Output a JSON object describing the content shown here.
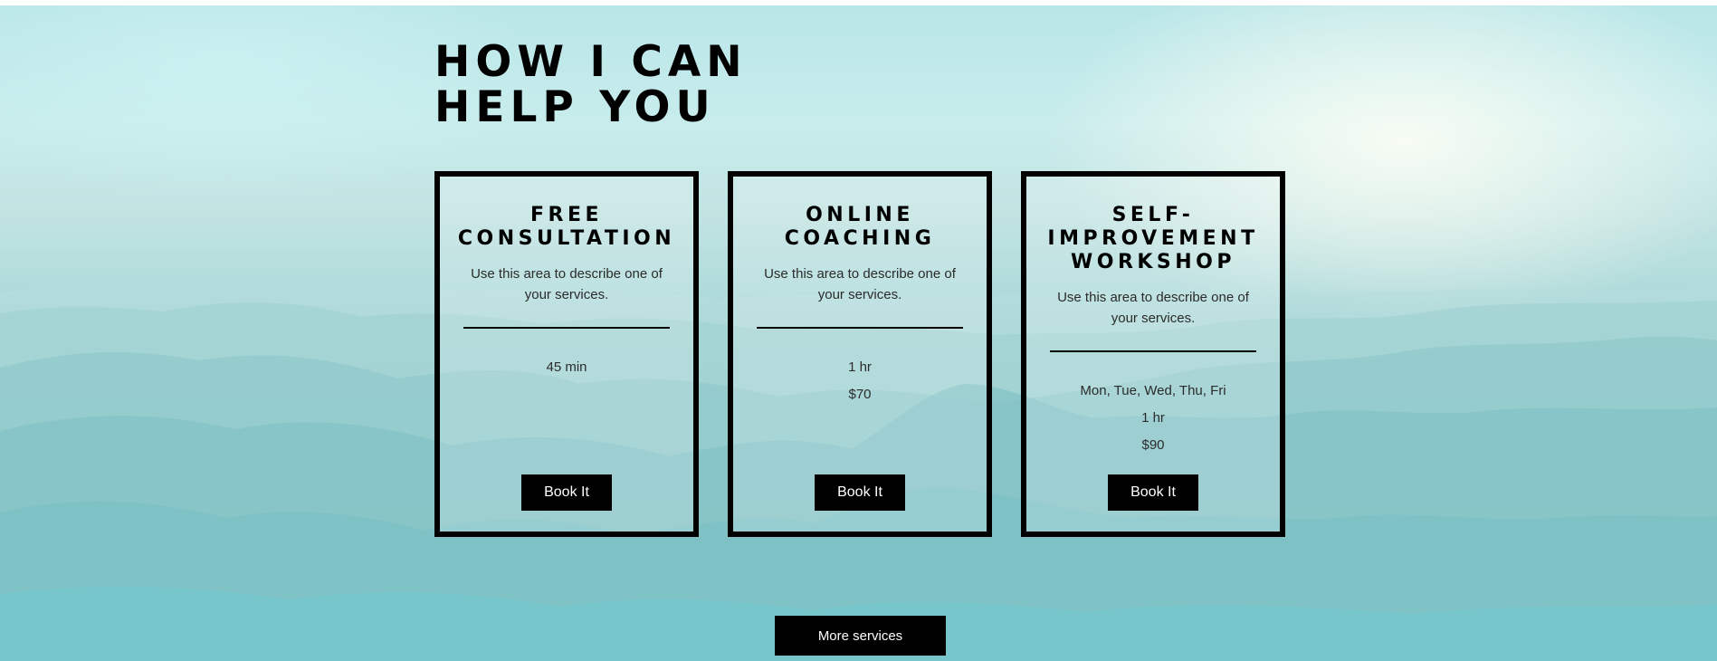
{
  "section": {
    "heading_line1": "HOW I CAN",
    "heading_line2": "HELP YOU"
  },
  "services": [
    {
      "title": "FREE CONSULTATION",
      "description": "Use this area to describe one of your services.",
      "details": [
        "45 min"
      ],
      "button_label": "Book It"
    },
    {
      "title": "ONLINE COACHING",
      "description": "Use this area to describe one of your services.",
      "details": [
        "1 hr",
        "$70"
      ],
      "button_label": "Book It"
    },
    {
      "title": "SELF-IMPROVEMENT WORKSHOP",
      "title_lines": [
        "SELF-",
        "IMPROVEMENT",
        "WORKSHOP"
      ],
      "description": "Use this area to describe one of your services.",
      "details": [
        "Mon, Tue, Wed, Thu, Fri",
        "1 hr",
        "$90"
      ],
      "button_label": "Book It"
    }
  ],
  "more_services_label": "More services",
  "colors": {
    "accent": "#000000",
    "button_text": "#ffffff",
    "background_sky": "#c8ecec",
    "background_mountains": "#7cc8cc"
  },
  "background_image": "misty-mountains-landscape"
}
